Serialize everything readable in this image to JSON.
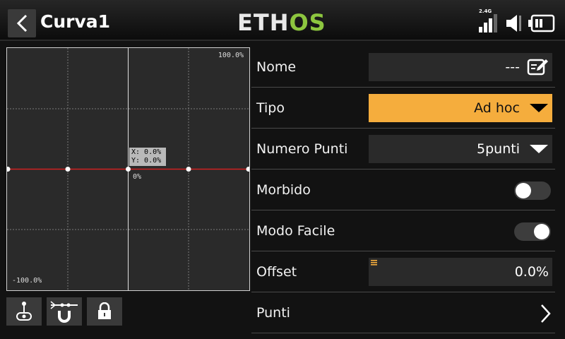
{
  "header": {
    "title": "Curva1",
    "logo_main": "ETH",
    "logo_accent": "OS",
    "signal_label": "2.4G"
  },
  "graph": {
    "top_label": "100.0%",
    "bottom_label": "-100.0%",
    "center_label": "0%",
    "coord_x": "X: 0.0%",
    "coord_y": "Y: 0.0%",
    "line_color": "#d02020"
  },
  "tools": [
    "stick-icon",
    "magnet-icon",
    "lock-icon"
  ],
  "rows": {
    "nome": {
      "label": "Nome",
      "value": "---"
    },
    "tipo": {
      "label": "Tipo",
      "value": "Ad hoc"
    },
    "numero_punti": {
      "label": "Numero Punti",
      "value": "5punti"
    },
    "morbido": {
      "label": "Morbido",
      "enabled": false
    },
    "modo_facile": {
      "label": "Modo Facile",
      "enabled": true
    },
    "offset": {
      "label": "Offset",
      "value": "0.0%"
    },
    "punti": {
      "label": "Punti"
    }
  },
  "colors": {
    "accent": "#f5ad3d",
    "logo_green": "#8dc63f",
    "field_bg": "#2a2a2a"
  }
}
